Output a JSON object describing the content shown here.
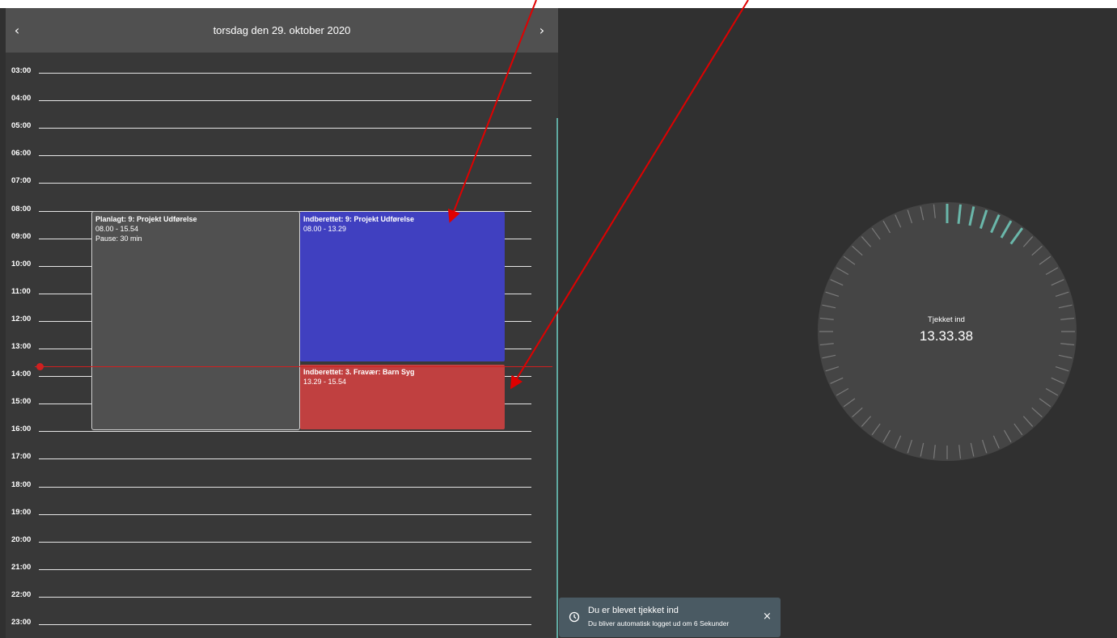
{
  "calendar": {
    "date_title": "torsdag den 29. oktober 2020",
    "prev_icon": "‹",
    "next_icon": "›",
    "hours": [
      "03:00",
      "04:00",
      "05:00",
      "06:00",
      "07:00",
      "08:00",
      "09:00",
      "10:00",
      "11:00",
      "12:00",
      "13:00",
      "14:00",
      "15:00",
      "16:00",
      "17:00",
      "18:00",
      "19:00",
      "20:00",
      "21:00",
      "22:00",
      "23:00"
    ],
    "events": {
      "planned": {
        "title": "Planlagt: 9: Projekt Udførelse",
        "time": "08.00 - 15.54",
        "pause": "Pause: 30 min",
        "color": "#505050"
      },
      "reported_work": {
        "title": "Indberettet: 9: Projekt Udførelse",
        "time": "08.00 - 13.29",
        "color": "#4040c0"
      },
      "reported_absence": {
        "title": "Indberettet: 3. Fravær: Barn Syg",
        "time": "13.29 - 15.54",
        "color": "#c04040"
      }
    },
    "now_line_color": "#d02020"
  },
  "dial": {
    "label": "Tjekket ind",
    "time": "13.33.38",
    "accent_color": "#6ab7aa"
  },
  "toast": {
    "icon": "clock-icon",
    "title": "Du er blevet tjekket ind",
    "message": "Du bliver automatisk logget ud om 6 Sekunder",
    "close": "×"
  }
}
